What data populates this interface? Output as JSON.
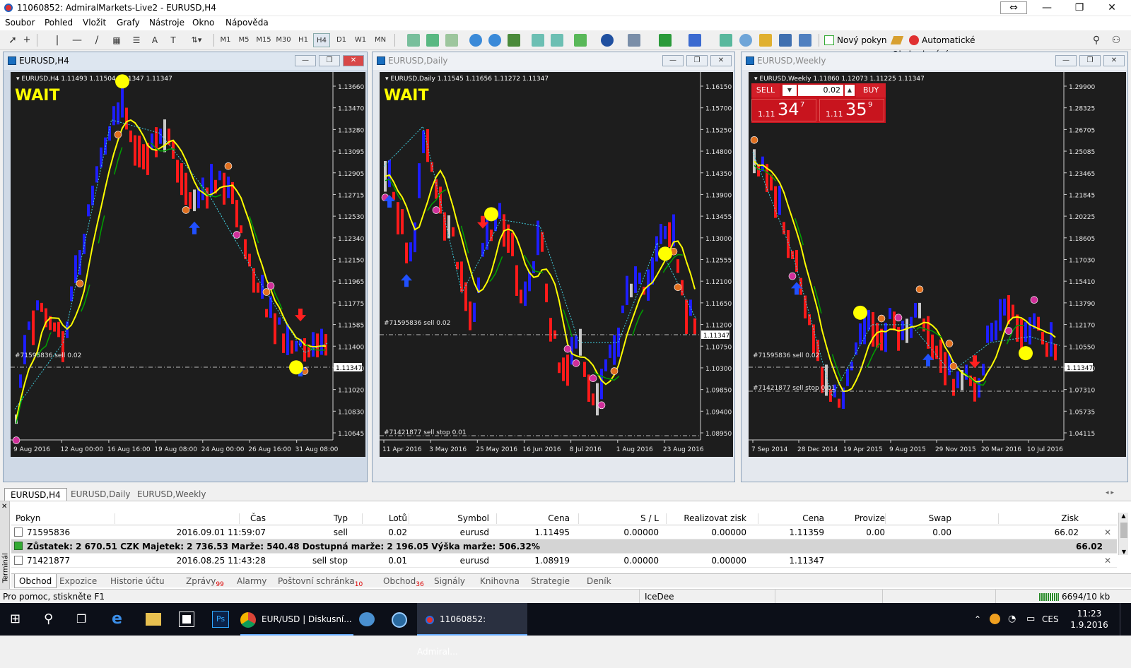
{
  "app": {
    "title": "11060852: AdmiralMarkets-Live2 - EURUSD,H4"
  },
  "menu": [
    "Soubor",
    "Pohled",
    "Vložit",
    "Grafy",
    "Nástroje",
    "Okno",
    "Nápověda"
  ],
  "toolbar": {
    "timeframes": [
      "M1",
      "M5",
      "M15",
      "M30",
      "H1",
      "H4",
      "D1",
      "W1",
      "MN"
    ],
    "new_order": "Nový pokyn",
    "auto_trading": "Automatické Obchodování"
  },
  "charts": [
    {
      "window_title": "EURUSD,H4",
      "info": "EURUSD,H4  1.11493 1.11504 1.11347 1.11347",
      "signal": "WAIT",
      "price_labels": [
        "1.13660",
        "1.13470",
        "1.13280",
        "1.13095",
        "1.12905",
        "1.12715",
        "1.12530",
        "1.12340",
        "1.12150",
        "1.11965",
        "1.11775",
        "1.11585",
        "1.11400",
        "1.11210",
        "1.11020",
        "1.10830",
        "1.10645"
      ],
      "current_price": "1.11347",
      "date_labels": [
        "9 Aug 2016",
        "12 Aug 00:00",
        "16 Aug 16:00",
        "19 Aug 08:00",
        "24 Aug 00:00",
        "26 Aug 16:00",
        "31 Aug 08:00"
      ],
      "order_lines": [
        "#71595836 sell 0.02"
      ]
    },
    {
      "window_title": "EURUSD,Daily",
      "info": "EURUSD,Daily  1.11545 1.11656 1.11272 1.11347",
      "signal": "WAIT",
      "price_labels": [
        "1.16150",
        "1.15700",
        "1.15250",
        "1.14800",
        "1.14350",
        "1.13900",
        "1.13455",
        "1.13000",
        "1.12555",
        "1.12100",
        "1.11650",
        "1.11200",
        "1.10750",
        "1.10300",
        "1.09850",
        "1.09400",
        "1.08950"
      ],
      "current_price": "1.11347",
      "date_labels": [
        "11 Apr 2016",
        "3 May 2016",
        "25 May 2016",
        "16 Jun 2016",
        "8 Jul 2016",
        "1 Aug 2016",
        "23 Aug 2016"
      ],
      "order_lines": [
        "#71595836 sell 0.02",
        "#71421877 sell stop 0.01"
      ]
    },
    {
      "window_title": "EURUSD,Weekly",
      "info": "EURUSD,Weekly  1.11860 1.12073 1.11225 1.11347",
      "price_labels": [
        "1.29900",
        "1.28325",
        "1.26705",
        "1.25085",
        "1.23465",
        "1.21845",
        "1.20225",
        "1.18605",
        "1.17030",
        "1.15410",
        "1.13790",
        "1.12170",
        "1.10550",
        "1.08930",
        "1.07310",
        "1.05735",
        "1.04115"
      ],
      "current_price": "1.11347",
      "date_labels": [
        "7 Sep 2014",
        "28 Dec 2014",
        "19 Apr 2015",
        "9 Aug 2015",
        "29 Nov 2015",
        "20 Mar 2016",
        "10 Jul 2016"
      ],
      "order_lines": [
        "#71595836 sell 0.02",
        "#71421877 sell stop 0.01"
      ],
      "one_click": {
        "sell": "SELL",
        "buy": "BUY",
        "lot": "0.02",
        "sell_price_small": "1.11",
        "sell_price_big": "34",
        "sell_price_sup": "7",
        "buy_price_small": "1.11",
        "buy_price_big": "35",
        "buy_price_sup": "9"
      }
    }
  ],
  "chart_tabs": [
    "EURUSD,H4",
    "EURUSD,Daily",
    "EURUSD,Weekly"
  ],
  "terminal": {
    "columns": [
      "Pokyn",
      "Čas",
      "Typ",
      "Lotů",
      "Symbol",
      "Cena",
      "S / L",
      "Realizovat zisk",
      "Cena",
      "Provize",
      "Swap",
      "Zisk"
    ],
    "rows": [
      [
        "71595836",
        "2016.09.01 11:59:07",
        "sell",
        "0.02",
        "eurusd",
        "1.11495",
        "0.00000",
        "0.00000",
        "1.11359",
        "0.00",
        "0.00",
        "66.02"
      ]
    ],
    "balance_line": "Zůstatek: 2 670.51 CZK  Majetek: 2 736.53  Marže: 540.48  Dostupná marže: 2 196.05  Výška marže: 506.32%",
    "balance_profit": "66.02",
    "pending": [
      "71421877",
      "2016.08.25 11:43:28",
      "sell stop",
      "0.01",
      "eurusd",
      "1.08919",
      "0.00000",
      "0.00000",
      "1.11347"
    ],
    "tabs": [
      {
        "label": "Obchod",
        "badge": ""
      },
      {
        "label": "Expozice",
        "badge": ""
      },
      {
        "label": "Historie účtu",
        "badge": ""
      },
      {
        "label": "Zprávy",
        "badge": "99"
      },
      {
        "label": "Alarmy",
        "badge": ""
      },
      {
        "label": "Poštovní schránka",
        "badge": "10"
      },
      {
        "label": "Obchod",
        "badge": "36"
      },
      {
        "label": "Signály",
        "badge": ""
      },
      {
        "label": "Knihovna",
        "badge": ""
      },
      {
        "label": "Strategie",
        "badge": ""
      },
      {
        "label": "Deník",
        "badge": ""
      }
    ],
    "side_label": "Terminál"
  },
  "status": {
    "help": "Pro pomoc, stiskněte F1",
    "profile": "IceDee",
    "traffic": "6694/10 kb"
  },
  "taskbar": {
    "items": [
      "EUR/USD | Diskusní...",
      "11060852: Admiral..."
    ],
    "lang": "CES",
    "time": "11:23",
    "date": "1.9.2016"
  },
  "colors": {
    "up": "#1e1eff",
    "down": "#ff1a1a",
    "neutral": "#c8c8c8",
    "ma_fast": "#ffff00",
    "ma_slow": "#00a000",
    "grid_bg": "#1d1d1d"
  }
}
